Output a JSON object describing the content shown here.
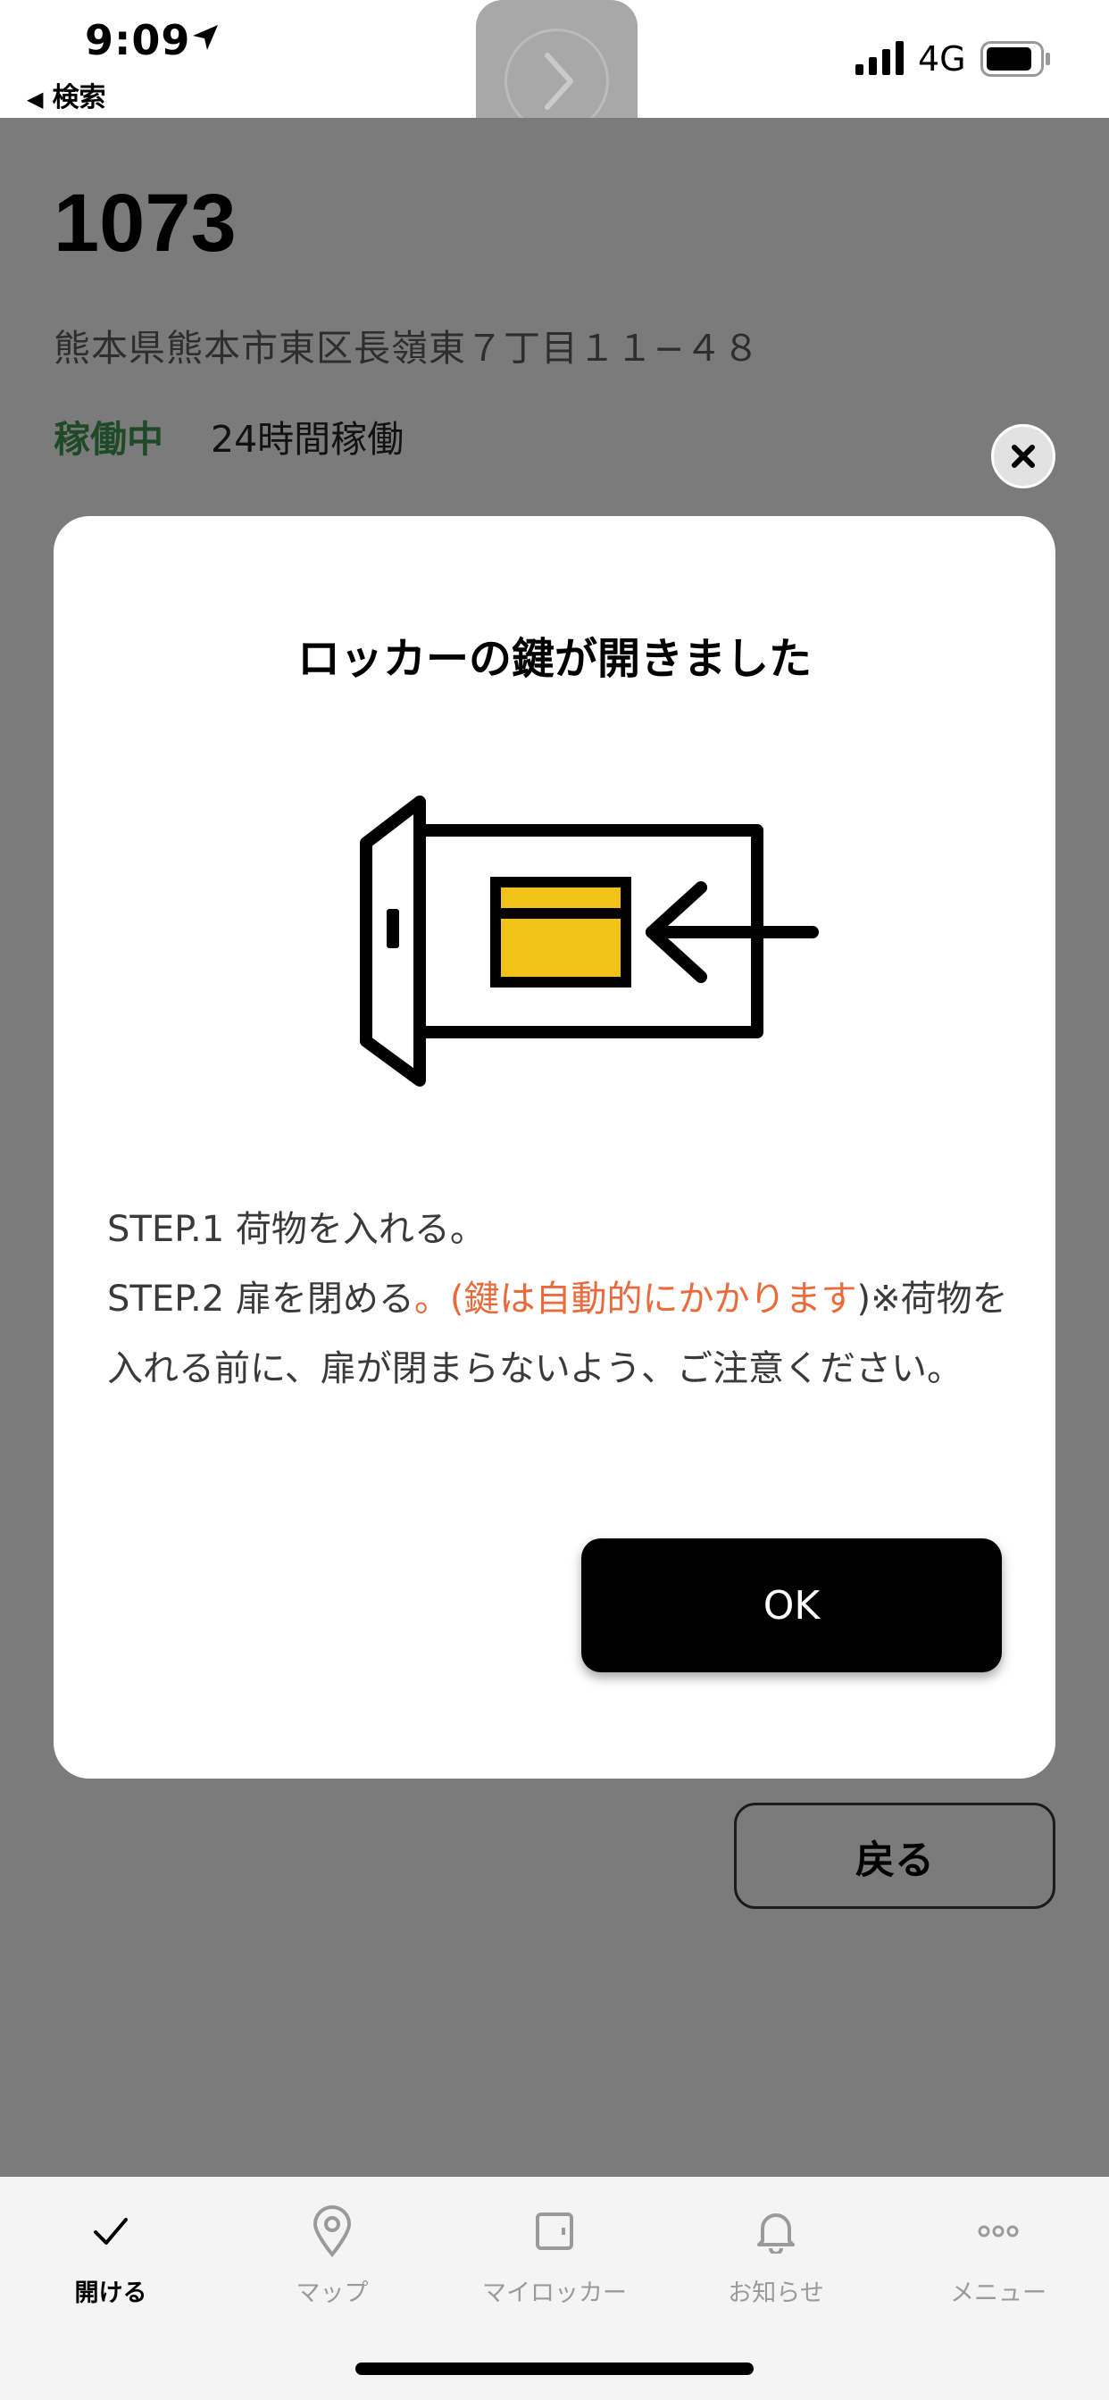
{
  "status_bar": {
    "time": "9:09",
    "back_app": "検索",
    "network": "4G"
  },
  "locker": {
    "id": "1073",
    "address": "熊本県熊本市東区長嶺東７丁目１１−４８",
    "status": "稼働中",
    "hours": "24時間稼働"
  },
  "modal": {
    "title": "ロッカーの鍵が開きました",
    "step1": "STEP.1 荷物を入れる。",
    "step2_prefix": "STEP.2 扉を閉める",
    "step2_warning": "。(鍵は自動的にかかります",
    "step2_suffix": ")※荷物を入れる前に、扉が閉まらないよう、ご注意ください。",
    "ok_label": "OK"
  },
  "back_button": "戻る",
  "tabs": [
    {
      "label": "開ける",
      "icon": "check-icon",
      "active": true
    },
    {
      "label": "マップ",
      "icon": "map-pin-icon",
      "active": false
    },
    {
      "label": "マイロッカー",
      "icon": "door-icon",
      "active": false
    },
    {
      "label": "お知らせ",
      "icon": "bell-icon",
      "active": false
    },
    {
      "label": "メニュー",
      "icon": "more-icon",
      "active": false
    }
  ],
  "colors": {
    "overlay": "#7b7b7b",
    "status_green": "#1e4a28",
    "warning_orange": "#e96a3a",
    "box_yellow": "#f2c21b"
  }
}
